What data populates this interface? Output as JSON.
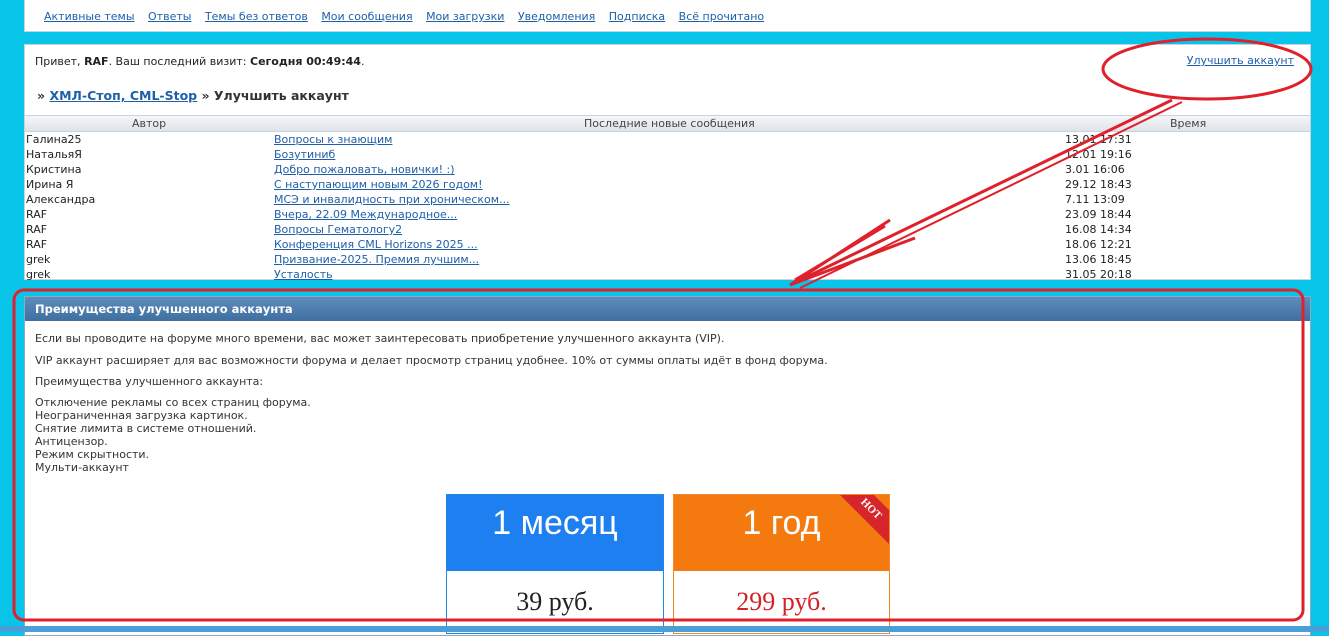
{
  "topmenu": {
    "items": [
      "Активные темы",
      "Ответы",
      "Темы без ответов",
      "Мои сообщения",
      "Мои загрузки",
      "Уведомления",
      "Подписка",
      "Всё прочитано"
    ]
  },
  "greeting": {
    "prefix": "Привет, ",
    "user": "RAF",
    "middle": ". Ваш последний визит: ",
    "visit": "Сегодня 00:49:44",
    "suffix": "."
  },
  "upgrade_link": "Улучшить аккаунт",
  "breadcrumb": {
    "sep1": "»",
    "forum": "ХМЛ-Стоп, CML-Stop",
    "sep2": "»",
    "current": "Улучшить аккаунт"
  },
  "table": {
    "headers": {
      "author": "Автор",
      "message": "Последние новые сообщения",
      "time": "Время"
    },
    "rows": [
      {
        "author": "Галина25",
        "message": "Вопросы к знающим",
        "time": "13.01 17:31"
      },
      {
        "author": "НатальяЯ",
        "message": "Бозутиниб",
        "time": "12.01 19:16"
      },
      {
        "author": "Кристина",
        "message": "Добро пожаловать, новички! :)",
        "time": "3.01 16:06"
      },
      {
        "author": "Ирина Я",
        "message": "С наступающим новым 2026 годом!",
        "time": "29.12 18:43"
      },
      {
        "author": "Александра",
        "message": "МСЭ и инвалидность при хроническом...",
        "time": "7.11 13:09"
      },
      {
        "author": "RAF",
        "message": "Вчера, 22.09 Международное...",
        "time": "23.09 18:44"
      },
      {
        "author": "RAF",
        "message": "Вопросы Гематологу2",
        "time": "16.08 14:34"
      },
      {
        "author": "RAF",
        "message": "Конференция CML Horizons 2025 ...",
        "time": "18.06 12:21"
      },
      {
        "author": "grek",
        "message": "Призвание-2025. Премия лучшим...",
        "time": "13.06 18:45"
      },
      {
        "author": "grek",
        "message": "Усталость",
        "time": "31.05 20:18"
      }
    ]
  },
  "benefits": {
    "title": "Преимущества улучшенного аккаунта",
    "p1": "Если вы проводите на форуме много времени, вас может заинтересовать приобретение улучшенного аккаунта (VIP).",
    "p2": "VIP аккаунт расширяет для вас возможности форума и делает просмотр страниц удобнее. 10% от суммы оплаты идёт в фонд форума.",
    "p3": "Преимущества улучшенного аккаунта:",
    "list": [
      "Отключение рекламы со всех страниц форума.",
      "Неограниченная загрузка картинок.",
      "Снятие лимита в системе отношений.",
      "Антицензор.",
      "Режим скрытности.",
      "Мульти-аккаунт"
    ]
  },
  "plans": [
    {
      "title": "1 месяц",
      "price": "39 руб.",
      "color": "#1e7ff0"
    },
    {
      "title": "1 год",
      "price": "299 руб.",
      "color": "#f47a0f",
      "badge": "HOT"
    }
  ],
  "annotation_color": "#e0202a"
}
